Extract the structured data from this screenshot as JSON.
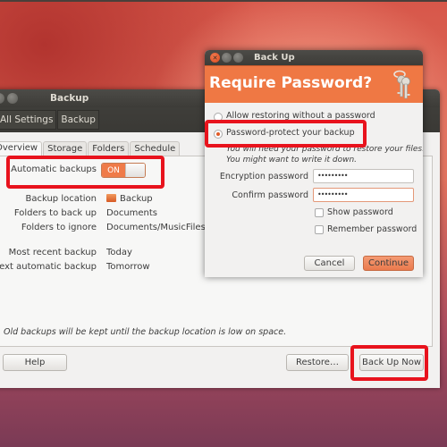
{
  "main_window": {
    "title": "Backup",
    "breadcrumbs": [
      "All Settings",
      "Backup"
    ],
    "tabs": [
      {
        "label": "Overview",
        "active": true
      },
      {
        "label": "Storage",
        "active": false
      },
      {
        "label": "Folders",
        "active": false
      },
      {
        "label": "Schedule",
        "active": false
      }
    ],
    "automatic_backups": {
      "label": "Automatic backups",
      "toggle_label": "ON",
      "state": "on"
    },
    "fields": [
      {
        "label": "Backup location",
        "value": "Backup",
        "icon": "folder-icon"
      },
      {
        "label": "Folders to back up",
        "value": "Documents"
      },
      {
        "label": "Folders to ignore",
        "value": "Documents/MusicFiles"
      },
      {
        "label": "Most recent backup",
        "value": "Today"
      },
      {
        "label": "Next automatic backup",
        "value": "Tomorrow"
      }
    ],
    "note": "Old backups will be kept until the backup location is low on space.",
    "buttons": {
      "help": "Help",
      "restore": "Restore…",
      "back_up_now": "Back Up Now"
    }
  },
  "dialog": {
    "title": "Back Up",
    "header": "Require Password?",
    "icon": "keys-icon",
    "options": [
      {
        "label": "Allow restoring without a password",
        "selected": false
      },
      {
        "label": "Password-protect your backup",
        "selected": true
      }
    ],
    "hint_line1": "You will need your password to restore your files.",
    "hint_line2": "You might want to write it down.",
    "encryption_password": {
      "label": "Encryption password",
      "value": "•••••••••"
    },
    "confirm_password": {
      "label": "Confirm password",
      "value": "•••••••••"
    },
    "show_password": {
      "label": "Show password",
      "checked": false
    },
    "remember_password": {
      "label": "Remember password",
      "checked": false
    },
    "buttons": {
      "cancel": "Cancel",
      "continue": "Continue"
    }
  },
  "colors": {
    "accent": "#ef7844",
    "highlight": "#e8131d",
    "titlebar": "#3d3c38"
  }
}
